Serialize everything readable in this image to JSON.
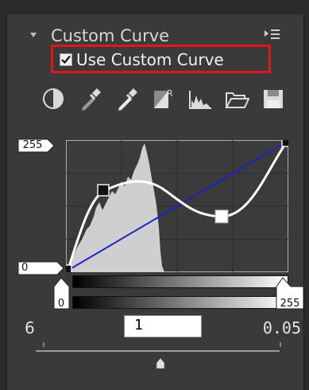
{
  "panel": {
    "title": "Custom Curve",
    "collapse_icon": "triangle-down-icon",
    "menu_icon": "panel-menu-icon"
  },
  "use_custom_curve": {
    "label": "Use Custom Curve",
    "checked": true,
    "highlight_color": "#e0161c"
  },
  "toolbar": {
    "tools": [
      {
        "name": "contrast-icon"
      },
      {
        "name": "black-point-eyedropper-icon"
      },
      {
        "name": "gray-point-eyedropper-icon"
      },
      {
        "name": "rgb-channel-icon"
      },
      {
        "name": "histogram-icon"
      },
      {
        "name": "open-folder-icon"
      },
      {
        "name": "save-icon"
      }
    ]
  },
  "curve": {
    "output_max": "255",
    "output_min": "0",
    "input_min": "0",
    "input_max": "255",
    "curve_color": "#ffffff",
    "diagonal_color": "#1a22c8",
    "histogram_color": "#cfcfcf"
  },
  "gamma": {
    "left_value": "6",
    "right_value": "0.05",
    "input_value": "1"
  }
}
